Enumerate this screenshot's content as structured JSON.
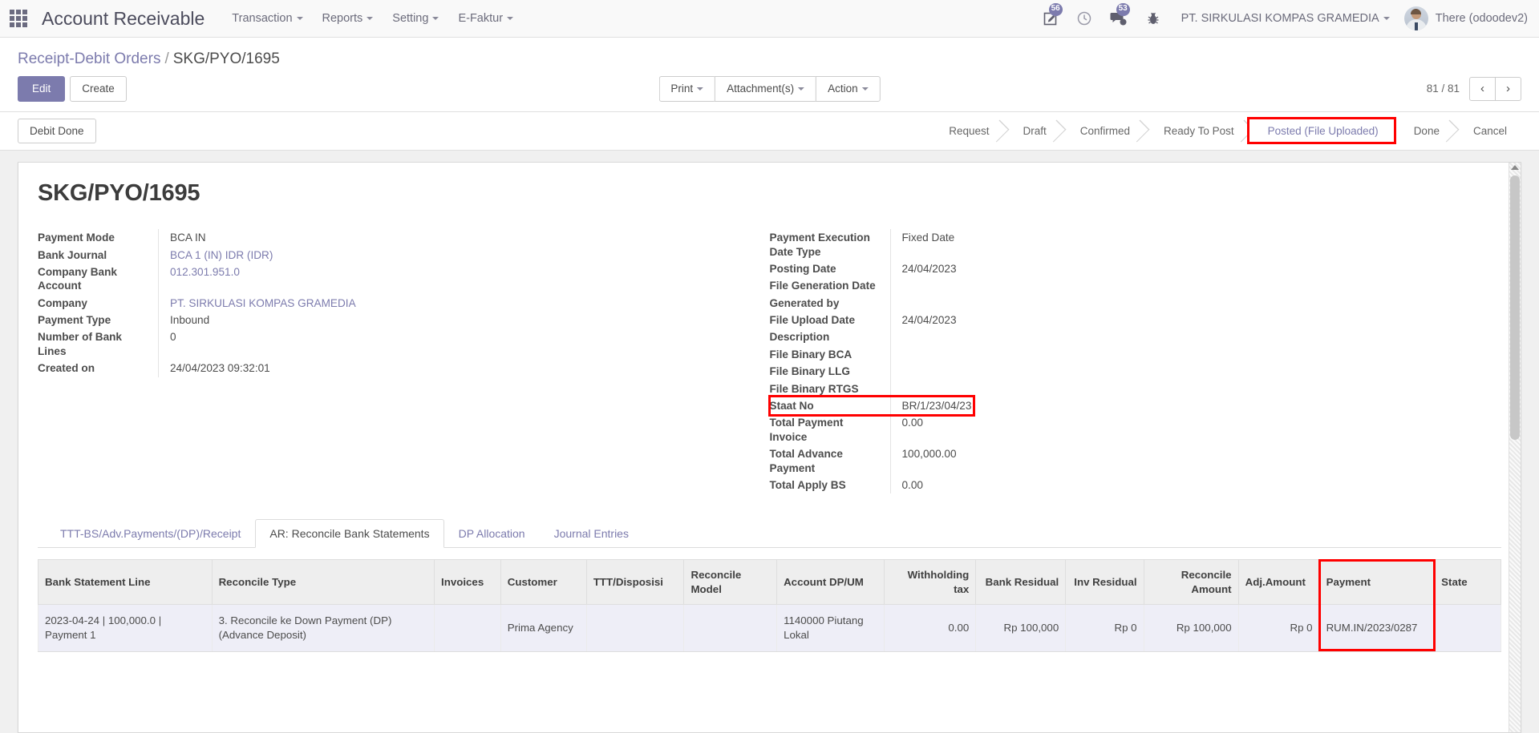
{
  "navbar": {
    "apps_icon": "apps-grid-icon",
    "app_title": "Account Receivable",
    "menu": [
      {
        "label": "Transaction"
      },
      {
        "label": "Reports"
      },
      {
        "label": "Setting"
      },
      {
        "label": "E-Faktur"
      }
    ],
    "icons": [
      {
        "name": "edit-note-icon",
        "badge": "56"
      },
      {
        "name": "clock-icon",
        "badge": ""
      },
      {
        "name": "messages-icon",
        "badge": "53"
      },
      {
        "name": "debug-bug-icon",
        "badge": ""
      }
    ],
    "company": "PT. SIRKULASI KOMPAS GRAMEDIA",
    "user": "There (odoodev2)"
  },
  "breadcrumb": {
    "root": "Receipt-Debit Orders",
    "separator": "/",
    "current": "SKG/PYO/1695"
  },
  "toolbar": {
    "edit_label": "Edit",
    "create_label": "Create",
    "center_buttons": [
      {
        "label": "Print"
      },
      {
        "label": "Attachment(s)"
      },
      {
        "label": "Action"
      }
    ],
    "pager_count": "81 / 81",
    "prev_icon": "chevron-left-icon",
    "next_icon": "chevron-right-icon"
  },
  "statusbar": {
    "action_button": "Debit Done",
    "stages": [
      {
        "label": "Request",
        "active": false,
        "highlighted": false
      },
      {
        "label": "Draft",
        "active": false,
        "highlighted": false
      },
      {
        "label": "Confirmed",
        "active": false,
        "highlighted": false
      },
      {
        "label": "Ready To Post",
        "active": false,
        "highlighted": false
      },
      {
        "label": "Posted (File Uploaded)",
        "active": true,
        "highlighted": true
      },
      {
        "label": "Done",
        "active": false,
        "highlighted": false
      },
      {
        "label": "Cancel",
        "active": false,
        "highlighted": false
      }
    ]
  },
  "form": {
    "record_title": "SKG/PYO/1695",
    "left_fields": [
      {
        "label": "Payment Mode",
        "value": "BCA IN",
        "link": false
      },
      {
        "label": "Bank Journal",
        "value": "BCA 1 (IN) IDR (IDR)",
        "link": true
      },
      {
        "label": "Company Bank Account",
        "value": "012.301.951.0",
        "link": true
      },
      {
        "label": "Company",
        "value": "PT. SIRKULASI KOMPAS GRAMEDIA",
        "link": true
      },
      {
        "label": "Payment Type",
        "value": "Inbound",
        "link": false
      },
      {
        "label": "Number of Bank Lines",
        "value": "0",
        "link": false
      },
      {
        "label": "Created on",
        "value": "24/04/2023 09:32:01",
        "link": false
      }
    ],
    "right_fields": [
      {
        "label": "Payment Execution Date Type",
        "value": "Fixed Date",
        "link": false,
        "highlighted": false
      },
      {
        "label": "Posting Date",
        "value": "24/04/2023",
        "link": false,
        "highlighted": false
      },
      {
        "label": "File Generation Date",
        "value": "",
        "link": false,
        "highlighted": false
      },
      {
        "label": "Generated by",
        "value": "",
        "link": false,
        "highlighted": false
      },
      {
        "label": "File Upload Date",
        "value": "24/04/2023",
        "link": false,
        "highlighted": false
      },
      {
        "label": "Description",
        "value": "",
        "link": false,
        "highlighted": false
      },
      {
        "label": "File Binary BCA",
        "value": "",
        "link": false,
        "highlighted": false
      },
      {
        "label": "File Binary LLG",
        "value": "",
        "link": false,
        "highlighted": false
      },
      {
        "label": "File Binary RTGS",
        "value": "",
        "link": false,
        "highlighted": false
      },
      {
        "label": "Staat No",
        "value": "BR/1/23/04/23",
        "link": false,
        "highlighted": true
      },
      {
        "label": "Total Payment Invoice",
        "value": "0.00",
        "link": false,
        "highlighted": false
      },
      {
        "label": "Total Advance Payment",
        "value": "100,000.00",
        "link": false,
        "highlighted": false
      },
      {
        "label": "Total Apply BS",
        "value": "0.00",
        "link": false,
        "highlighted": false
      }
    ]
  },
  "notebook": {
    "tabs": [
      {
        "label": "TTT-BS/Adv.Payments/(DP)/Receipt",
        "active": false
      },
      {
        "label": "AR: Reconcile Bank Statements",
        "active": true
      },
      {
        "label": "DP Allocation",
        "active": false
      },
      {
        "label": "Journal Entries",
        "active": false
      }
    ]
  },
  "table": {
    "columns": [
      {
        "label": "Bank Statement Line",
        "align": "left",
        "width": "178",
        "highlighted": false
      },
      {
        "label": "Reconcile Type",
        "align": "left",
        "width": "228",
        "highlighted": false
      },
      {
        "label": "Invoices",
        "align": "left",
        "width": "68",
        "highlighted": false
      },
      {
        "label": "Customer",
        "align": "left",
        "width": "88",
        "highlighted": false
      },
      {
        "label": "TTT/Disposisi",
        "align": "left",
        "width": "100",
        "highlighted": false
      },
      {
        "label": "Reconcile Model",
        "align": "left",
        "width": "95",
        "highlighted": false
      },
      {
        "label": "Account DP/UM",
        "align": "left",
        "width": "110",
        "highlighted": false
      },
      {
        "label": "Withholding tax",
        "align": "right",
        "width": "94",
        "highlighted": false
      },
      {
        "label": "Bank Residual",
        "align": "right",
        "width": "92",
        "highlighted": false
      },
      {
        "label": "Inv Residual",
        "align": "right",
        "width": "80",
        "highlighted": false
      },
      {
        "label": "Reconcile Amount",
        "align": "right",
        "width": "97",
        "highlighted": false
      },
      {
        "label": "Adj.Amount",
        "align": "left",
        "width": "83",
        "highlighted": false
      },
      {
        "label": "Payment",
        "align": "left",
        "width": "118",
        "highlighted": true
      },
      {
        "label": "State",
        "align": "left",
        "width": "68",
        "highlighted": false
      }
    ],
    "rows": [
      {
        "cells": [
          "2023-04-24 | 100,000.0 | Payment 1",
          "3. Reconcile ke Down Payment (DP) (Advance Deposit)",
          "",
          "Prima Agency",
          "",
          "",
          "1140000 Piutang Lokal",
          "0.00",
          "Rp 100,000",
          "Rp 0",
          "Rp 100,000",
          "Rp 0",
          "RUM.IN/2023/0287",
          ""
        ]
      }
    ]
  },
  "colors": {
    "accent": "#7c7bad",
    "highlight": "#ff0000",
    "row_bg": "#eeeef7",
    "header_bg": "#eeeeee"
  }
}
